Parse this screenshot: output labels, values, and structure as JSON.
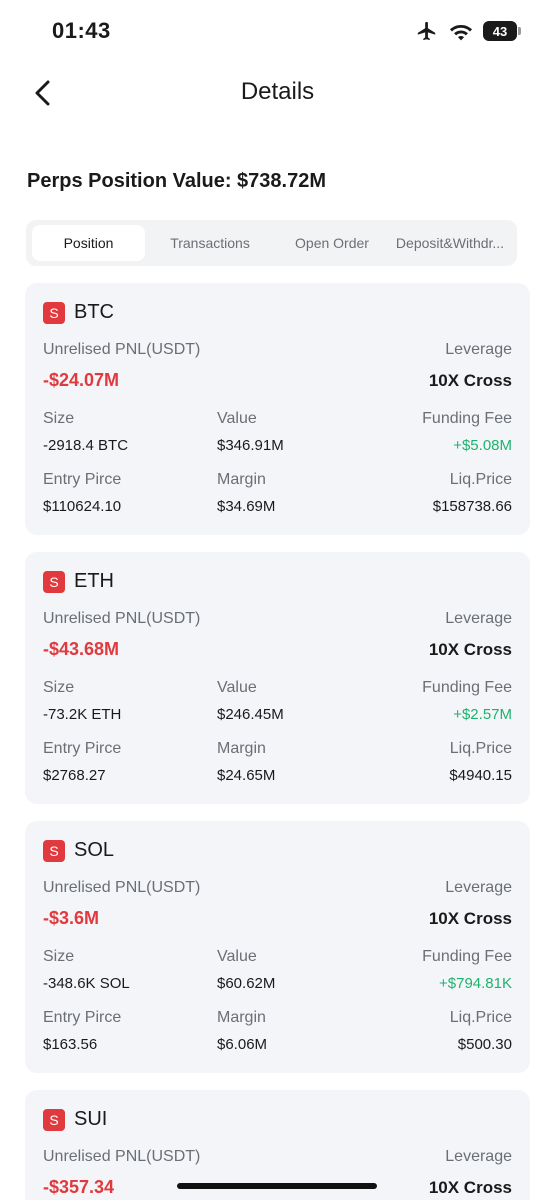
{
  "status": {
    "time": "01:43",
    "battery": "43"
  },
  "header": {
    "title": "Details"
  },
  "summary": {
    "position_value": "Perps Position Value: $738.72M"
  },
  "tabs": [
    {
      "label": "Position"
    },
    {
      "label": "Transactions"
    },
    {
      "label": "Open Order"
    },
    {
      "label": "Deposit&Withdr..."
    }
  ],
  "labels": {
    "unrealised_pnl": "Unrelised PNL(USDT)",
    "leverage": "Leverage",
    "size": "Size",
    "value": "Value",
    "funding_fee": "Funding Fee",
    "entry_price": "Entry Pirce",
    "margin": "Margin",
    "liq_price": "Liq.Price"
  },
  "badge_letter": "S",
  "positions": [
    {
      "coin": "BTC",
      "pnl": "-$24.07M",
      "leverage": "10X Cross",
      "size": "-2918.4 BTC",
      "value": "$346.91M",
      "funding_fee": "+$5.08M",
      "entry_price": "$110624.10",
      "margin": "$34.69M",
      "liq_price": "$158738.66"
    },
    {
      "coin": "ETH",
      "pnl": "-$43.68M",
      "leverage": "10X Cross",
      "size": "-73.2K ETH",
      "value": "$246.45M",
      "funding_fee": "+$2.57M",
      "entry_price": "$2768.27",
      "margin": "$24.65M",
      "liq_price": "$4940.15"
    },
    {
      "coin": "SOL",
      "pnl": "-$3.6M",
      "leverage": "10X Cross",
      "size": "-348.6K SOL",
      "value": "$60.62M",
      "funding_fee": "+$794.81K",
      "entry_price": "$163.56",
      "margin": "$6.06M",
      "liq_price": "$500.30"
    },
    {
      "coin": "SUI",
      "pnl": "-$357.34",
      "leverage": "10X Cross"
    }
  ],
  "colors": {
    "loss": "#e0393e",
    "gain": "#1fb26e",
    "card_bg": "#f3f5f8"
  }
}
